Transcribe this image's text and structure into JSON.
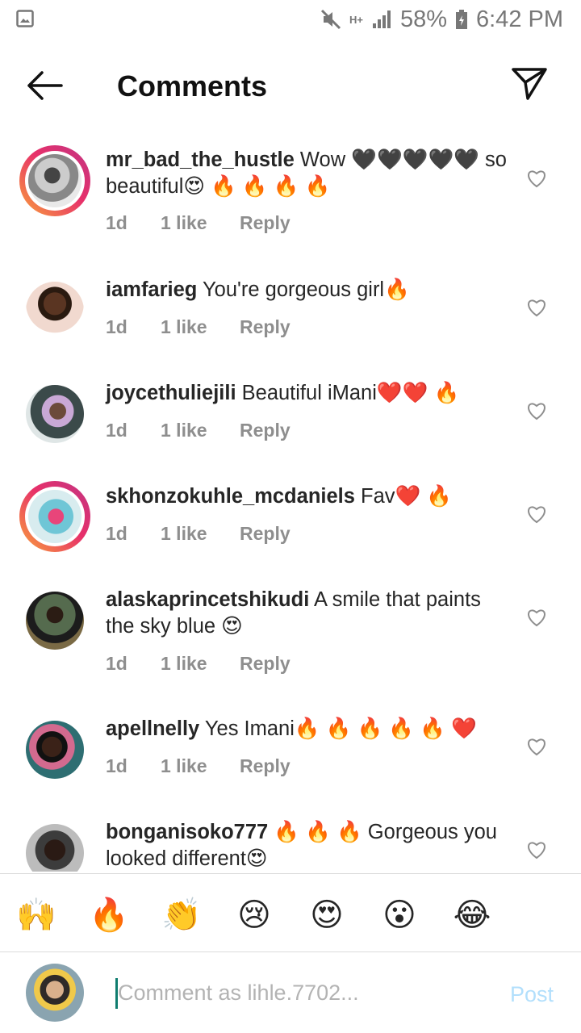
{
  "status_bar": {
    "battery": "58%",
    "time": "6:42 PM",
    "network": "H+",
    "icons": [
      "gallery-icon",
      "mute-icon",
      "signal-icon",
      "battery-icon"
    ]
  },
  "header": {
    "title": "Comments",
    "back_icon": "arrow-left-icon",
    "share_icon": "paper-plane-icon"
  },
  "comments": [
    {
      "user": "mr_bad_the_hustle",
      "text": " Wow 🖤🖤🖤🖤🖤 so beautiful😍 🔥 🔥 🔥 🔥",
      "time": "1d",
      "likes": "1 like",
      "reply": "Reply",
      "story_ring": true
    },
    {
      "user": "iamfarieg",
      "text": " You're gorgeous girl🔥",
      "time": "1d",
      "likes": "1 like",
      "reply": "Reply",
      "story_ring": false
    },
    {
      "user": "joycethuliejili",
      "text": " Beautiful iMani❤️❤️ 🔥",
      "time": "1d",
      "likes": "1 like",
      "reply": "Reply",
      "story_ring": false
    },
    {
      "user": "skhonzokuhle_mcdaniels",
      "text": " Fav❤️ 🔥",
      "time": "1d",
      "likes": "1 like",
      "reply": "Reply",
      "story_ring": true
    },
    {
      "user": "alaskaprincetshikudi",
      "text": " A smile that paints the sky blue 😍",
      "time": "1d",
      "likes": "1 like",
      "reply": "Reply",
      "story_ring": false
    },
    {
      "user": "apellnelly",
      "text": " Yes Imani🔥 🔥 🔥 🔥 🔥 ❤️",
      "time": "1d",
      "likes": "1 like",
      "reply": "Reply",
      "story_ring": false
    },
    {
      "user": "bonganisoko777",
      "text": " 🔥 🔥 🔥  Gorgeous you looked different😍",
      "story_ring": false
    }
  ],
  "reactions": [
    "🙌",
    "🔥",
    "👏",
    "😢",
    "😍",
    "😮",
    "😂"
  ],
  "composer": {
    "placeholder": "Comment as lihle.7702...",
    "post_label": "Post"
  },
  "colors": {
    "accent_post": "#b2dffc",
    "meta_gray": "#8e8e8e",
    "caret": "#0f7d6f"
  }
}
